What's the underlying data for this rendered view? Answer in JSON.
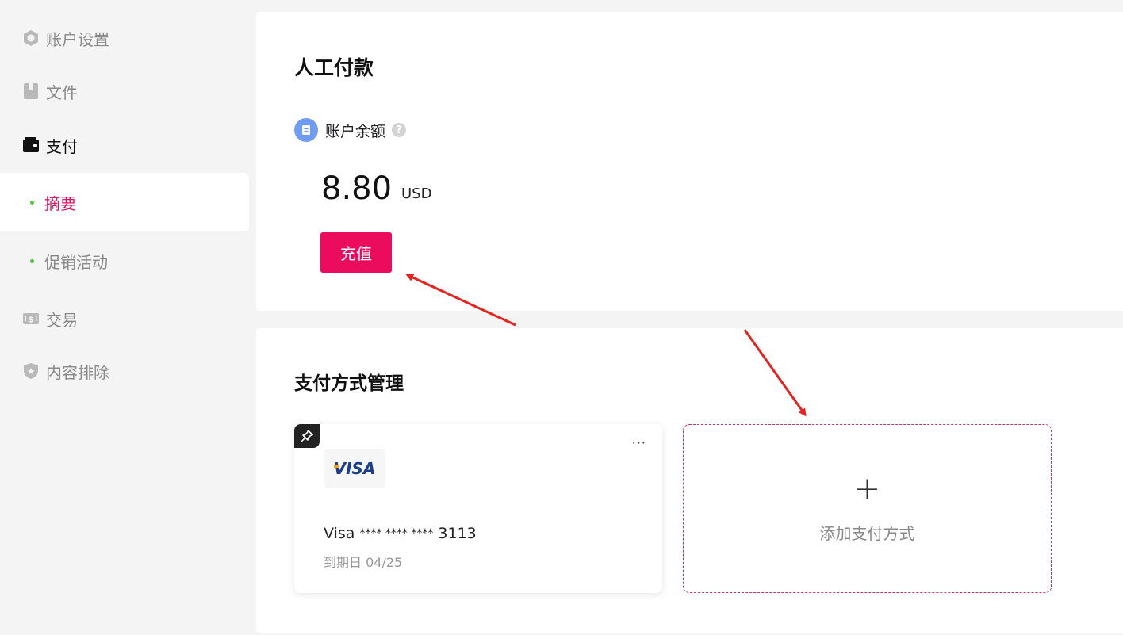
{
  "sidebar": {
    "items": [
      {
        "label": "账户设置",
        "icon": "gear-icon"
      },
      {
        "label": "文件",
        "icon": "file-icon"
      },
      {
        "label": "支付",
        "icon": "wallet-icon"
      },
      {
        "label": "交易",
        "icon": "money-icon"
      },
      {
        "label": "内容排除",
        "icon": "shield-icon"
      }
    ],
    "sub_items": [
      {
        "label": "摘要",
        "selected": true
      },
      {
        "label": "促销活动",
        "selected": false
      }
    ]
  },
  "balance_section": {
    "title": "人工付款",
    "balance_label": "账户余额",
    "help_mark": "?",
    "amount": "8.80",
    "currency": "USD",
    "topup_label": "充值"
  },
  "payment_section": {
    "title": "支付方式管理",
    "card": {
      "brand": "VISA",
      "brand_name": "Visa",
      "masked": "**** **** ****",
      "last4": "3113",
      "expiry": "到期日 04/25",
      "more": "···"
    },
    "add_label": "添加支付方式",
    "add_symbol": "+"
  },
  "colors": {
    "accent": "#ec0c5d",
    "selected_text": "#e0115f",
    "dot_green": "#58c14a",
    "balance_icon_bg": "#6f9cf4",
    "annotation_arrow": "#e8231d"
  }
}
